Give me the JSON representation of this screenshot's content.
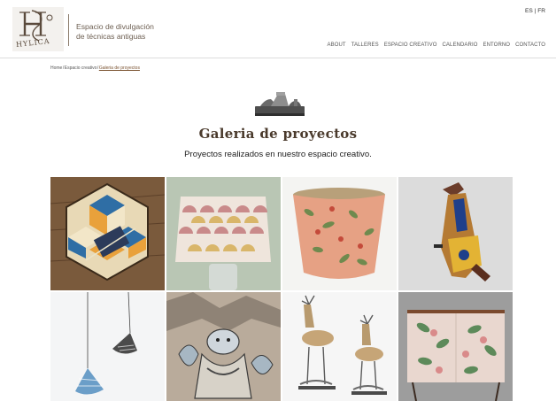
{
  "header": {
    "logo_text": "HYLICA",
    "tagline_line1": "Espacio de divulgación",
    "tagline_line2": "de técnicas antiguas"
  },
  "lang": {
    "es": "ES",
    "separator": "|",
    "fr": "FR"
  },
  "nav": {
    "items": [
      "ABOUT",
      "TALLERES",
      "ESPACIO CREATIVO",
      "CALENDARIO",
      "ENTORNO",
      "CONTACTO"
    ]
  },
  "breadcrumb": {
    "home": "Home",
    "section": "Espacio creativo",
    "current": "Galeria de proyectos",
    "separator": "/"
  },
  "main": {
    "icon": "hand-plane-icon",
    "title": "Galeria de proyectos",
    "subtitle": "Proyectos realizados en nuestro espacio creativo."
  },
  "gallery": {
    "items": [
      "hexagon-tray-project",
      "lampshade-project",
      "painted-bowl-project",
      "hurdy-gurdy-project",
      "pendant-lamps-project",
      "figure-panel-project",
      "wooden-deer-project",
      "floral-cabinet-project"
    ]
  }
}
